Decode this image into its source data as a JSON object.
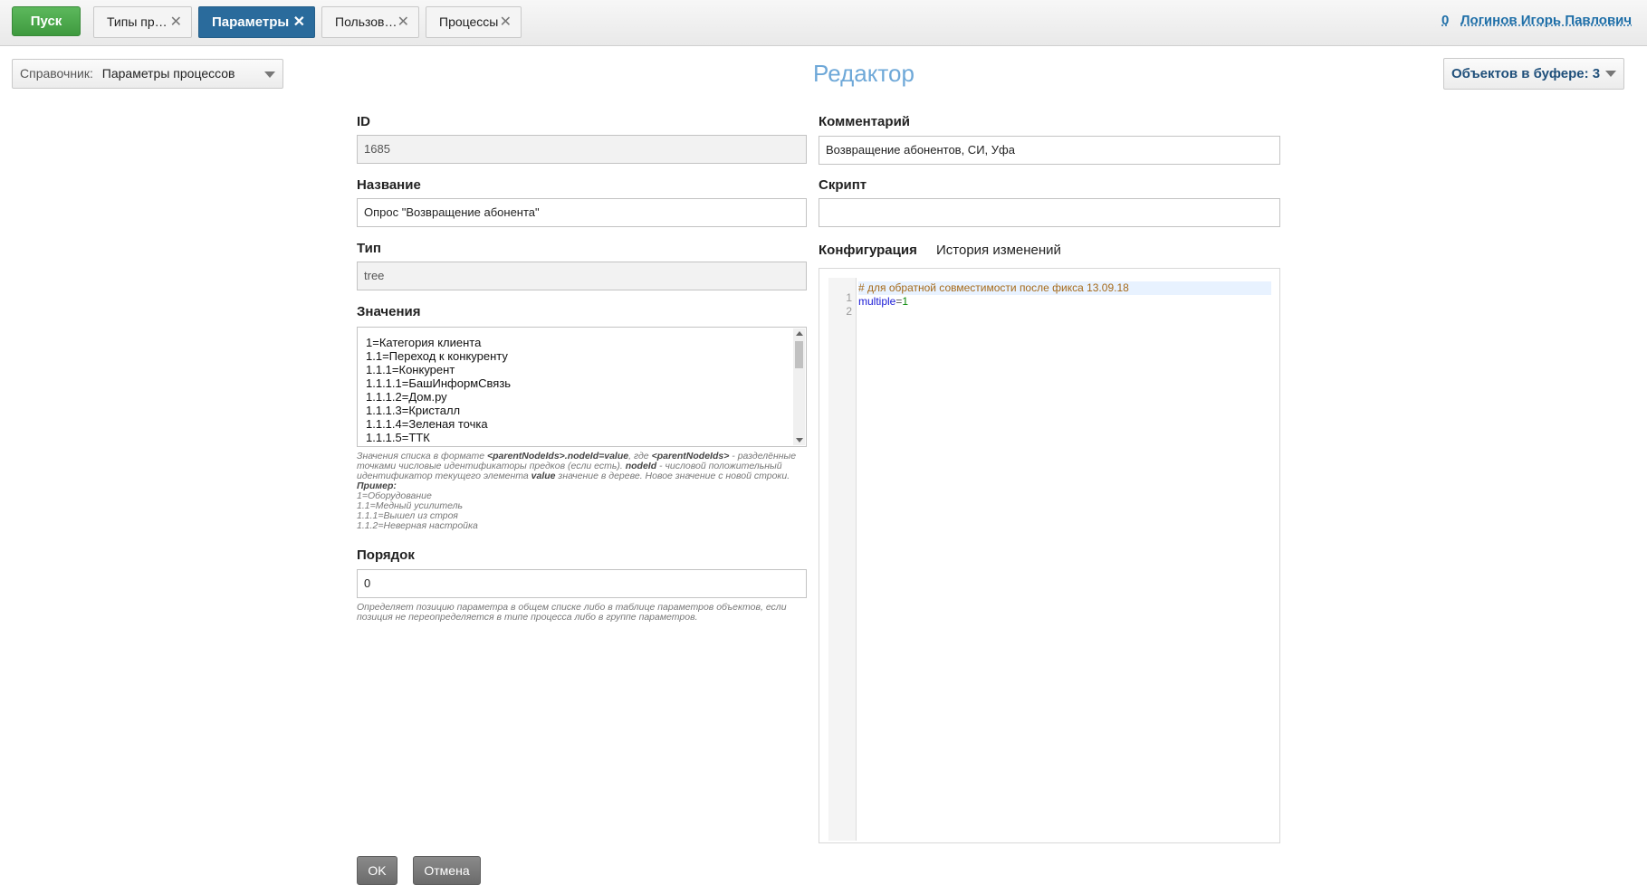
{
  "topbar": {
    "start_label": "Пуск",
    "tabs": [
      {
        "label": "Типы пр…"
      },
      {
        "label": "Параметры"
      },
      {
        "label": "Пользов…"
      },
      {
        "label": "Процессы"
      }
    ],
    "close_glyph": "✕",
    "user_count": "0",
    "user_name": "Логинов Игорь Павлович"
  },
  "toolbar": {
    "directory_label": "Справочник:",
    "directory_value": "Параметры процессов",
    "page_title": "Редактор",
    "buffer_label": "Объектов в буфере: 3"
  },
  "form": {
    "id_label": "ID",
    "id_value": "1685",
    "name_label": "Название",
    "name_value": "Опрос \"Возвращение абонента\"",
    "type_label": "Тип",
    "type_value": "tree",
    "values_label": "Значения",
    "values_lines": [
      "1=Категория клиента",
      "1.1=Переход к конкуренту",
      "1.1.1=Конкурент",
      "1.1.1.1=БашИнформСвязь",
      "1.1.1.2=Дом.ру",
      "1.1.1.3=Кристалл",
      "1.1.1.4=Зеленая точка",
      "1.1.1.5=ТТК"
    ],
    "values_hint": {
      "p1": "Значения списка в формате ",
      "b1": "<parentNodeIds>.nodeId=value",
      "p2": ", где ",
      "b2": "<parentNodeIds>",
      "p3": " - разделённые точками числовые идентификаторы предков (если есть). ",
      "b3": "nodeId",
      "p4": " - числовой положительный идентификатор текущего элемента ",
      "b4": "value",
      "p5": " значение в дереве. Новое значение с новой строки.",
      "example_title": "Пример:",
      "example_lines": [
        "1=Оборудование",
        "1.1=Медный усилитель",
        "1.1.1=Вышел из строя",
        "1.1.2=Неверная настройка"
      ]
    },
    "order_label": "Порядок",
    "order_value": "0",
    "order_hint": "Определяет позицию параметра в общем списке либо в таблице параметров объектов, если позиция не переопределяется в типе процесса либо в группе параметров.",
    "comment_label": "Комментарий",
    "comment_value": "Возвращение абонентов, СИ, Уфа",
    "script_label": "Скрипт",
    "script_value": "",
    "config_tab": "Конфигурация",
    "history_tab": "История изменений",
    "config_lines": [
      {
        "num": "1",
        "comment": "# для обратной совместимости после фикса 13.09.18"
      },
      {
        "num": "2",
        "key": "multiple",
        "eq": "=",
        "val": "1"
      }
    ],
    "ok_label": "OK",
    "cancel_label": "Отмена"
  }
}
